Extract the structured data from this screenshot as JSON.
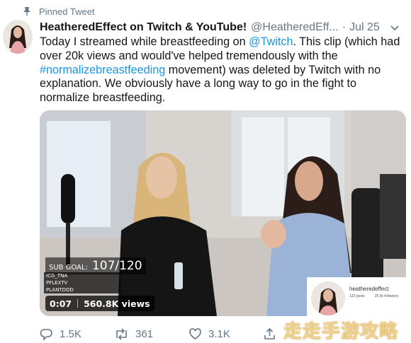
{
  "pinned": {
    "label": "Pinned Tweet"
  },
  "author": {
    "display_name": "HeatheredEffect on Twitch & YouTube!",
    "handle": "@HeatheredEff...",
    "separator": "·",
    "date": "Jul 25"
  },
  "tweet": {
    "text_1": "Today I streamed while breastfeeding on ",
    "mention": "@Twitch",
    "text_2": ". This clip (which had over 20k views and would've helped tremendously with the ",
    "hashtag": "#normalizebreastfeeding",
    "text_3": " movement) was deleted by Twitch with no explanation. We obviously have a long way to go in the fight to normalize breastfeeding."
  },
  "media": {
    "sub_goal_label": "SUB GOAL:",
    "sub_goal_value": "107/120",
    "sub_list": [
      {
        "name": "ICG_TNA",
        "value": ""
      },
      {
        "name": "PFLEXTV",
        "value": ""
      },
      {
        "name": "PLANTDDD",
        "value": ""
      }
    ],
    "duration": "0:07",
    "views": "560.8K views",
    "cam_overlay": {
      "name": "heatheredeffect",
      "stat_1": "122 posts",
      "stat_2": "25.5k followers"
    }
  },
  "actions": {
    "reply_count": "1.5K",
    "retweet_count": "361",
    "like_count": "3.1K"
  },
  "watermark": {
    "text": "走走手游攻略"
  },
  "colors": {
    "link": "#1b95e0",
    "secondary": "#657786"
  }
}
